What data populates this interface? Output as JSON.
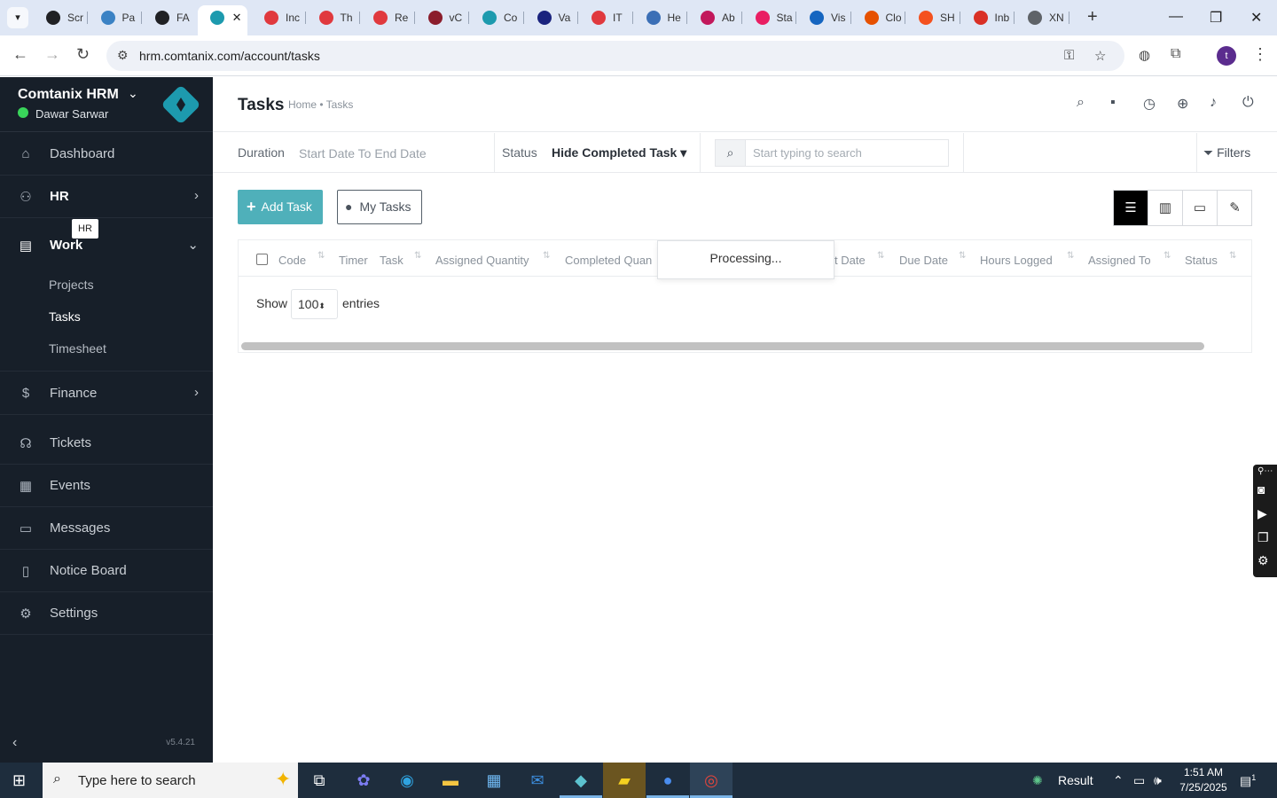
{
  "browser": {
    "tabs": [
      {
        "label": "Scr",
        "color": "#202124"
      },
      {
        "label": "Pa",
        "color": "#3b82c4"
      },
      {
        "label": "FA",
        "color": "#202124"
      },
      {
        "label": "",
        "color": "#1d9aae"
      },
      {
        "label": "Inc",
        "color": "#e0393e"
      },
      {
        "label": "Th",
        "color": "#e0393e"
      },
      {
        "label": "Re",
        "color": "#e0393e"
      },
      {
        "label": "vC",
        "color": "#8b1d2c"
      },
      {
        "label": "Co",
        "color": "#1d9aae"
      },
      {
        "label": "Va",
        "color": "#1a237e"
      },
      {
        "label": "IT",
        "color": "#e0393e"
      },
      {
        "label": "He",
        "color": "#3b6fb6"
      },
      {
        "label": "Ab",
        "color": "#c2185b"
      },
      {
        "label": "Sta",
        "color": "#e91e63"
      },
      {
        "label": "Vis",
        "color": "#1565c0"
      },
      {
        "label": "Clo",
        "color": "#e65100"
      },
      {
        "label": "SH",
        "color": "#f4511e"
      },
      {
        "label": "Inb",
        "color": "#d93025"
      },
      {
        "label": "XN",
        "color": "#5f6368"
      }
    ],
    "url": "hrm.comtanix.com/account/tasks",
    "profile_initial": "t"
  },
  "sidebar": {
    "company": "Comtanix HRM",
    "user": "Dawar Sarwar",
    "items": [
      {
        "label": "Dashboard",
        "icon": "home-icon"
      },
      {
        "label": "HR",
        "icon": "users-icon"
      },
      {
        "label": "Work",
        "icon": "briefcase-icon"
      },
      {
        "label": "Finance",
        "icon": "dollar-icon"
      },
      {
        "label": "Tickets",
        "icon": "headset-icon"
      },
      {
        "label": "Events",
        "icon": "calendar-icon"
      },
      {
        "label": "Messages",
        "icon": "message-icon"
      },
      {
        "label": "Notice Board",
        "icon": "clipboard-icon"
      },
      {
        "label": "Settings",
        "icon": "gear-icon"
      }
    ],
    "work_sub": [
      "Projects",
      "Tasks",
      "Timesheet"
    ],
    "tooltip": "HR",
    "version": "v5.4.21"
  },
  "header": {
    "title": "Tasks",
    "breadcrumb": "Home • Tasks"
  },
  "filters": {
    "duration_label": "Duration",
    "duration_placeholder": "Start Date To End Date",
    "status_label": "Status",
    "status_value": "Hide Completed Task",
    "search_placeholder": "Start typing to search",
    "filters_label": "Filters"
  },
  "actions": {
    "add_task": "Add Task",
    "my_tasks": "My Tasks"
  },
  "table": {
    "columns": [
      "Code",
      "Timer",
      "Task",
      "Assigned Quantity",
      "Completed Quan",
      "t Date",
      "Due Date",
      "Hours Logged",
      "Assigned To",
      "Status"
    ],
    "processing": "Processing...",
    "show_label": "Show",
    "entries_value": "100",
    "entries_label": "entries"
  },
  "taskbar": {
    "search_placeholder": "Type here to search",
    "weather": "Result",
    "time": "1:51 AM",
    "date": "7/25/2025",
    "notification_count": "1"
  }
}
